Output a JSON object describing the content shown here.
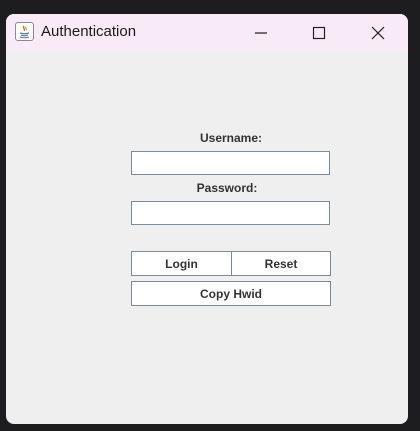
{
  "window": {
    "title": "Authentication"
  },
  "form": {
    "username_label": "Username:",
    "username_value": "",
    "password_label": "Password:",
    "password_value": "",
    "login_label": "Login",
    "reset_label": "Reset",
    "copy_hwid_label": "Copy Hwid"
  },
  "icons": {
    "app": "java-icon",
    "minimize": "minimize-icon",
    "maximize": "maximize-icon",
    "close": "close-icon"
  }
}
